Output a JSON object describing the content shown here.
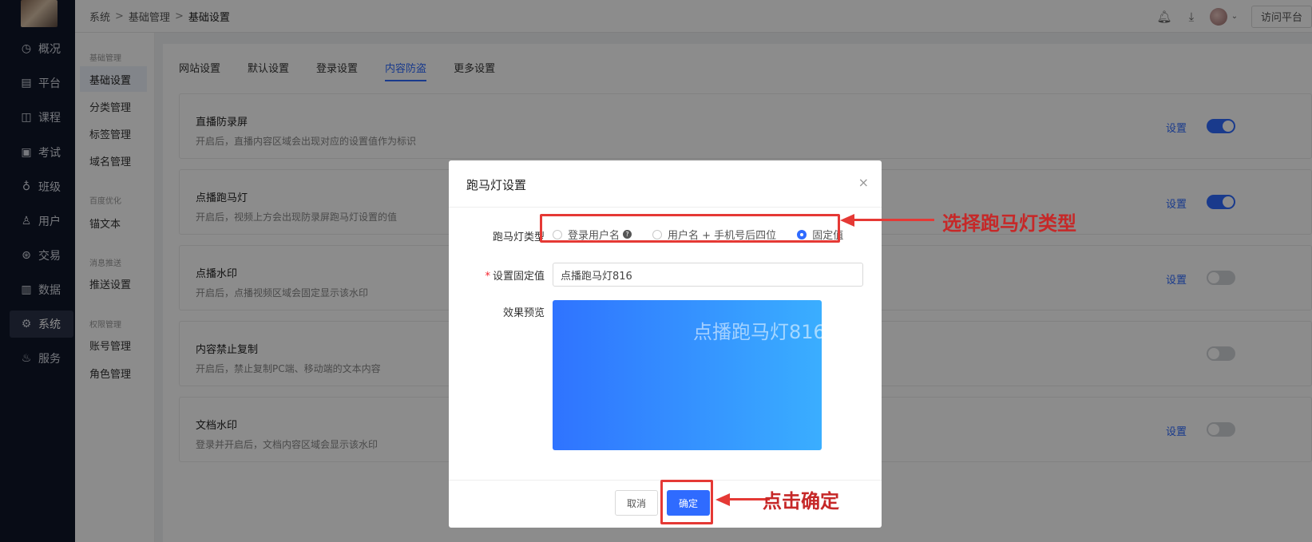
{
  "breadcrumb": [
    "系统",
    "基础管理",
    "基础设置"
  ],
  "breadcrumb_sep": ">",
  "top_actions": {
    "bell_icon": "bell-icon",
    "download_icon": "download-icon",
    "visit_label": "访问平台"
  },
  "nav": {
    "items": [
      {
        "label": "概况",
        "icon": "◷"
      },
      {
        "label": "平台",
        "icon": "▤"
      },
      {
        "label": "课程",
        "icon": "◫"
      },
      {
        "label": "考试",
        "icon": "▣"
      },
      {
        "label": "班级",
        "icon": "♁"
      },
      {
        "label": "用户",
        "icon": "♙"
      },
      {
        "label": "交易",
        "icon": "⊛"
      },
      {
        "label": "数据",
        "icon": "▥"
      },
      {
        "label": "系统",
        "icon": "⚙"
      },
      {
        "label": "服务",
        "icon": "♨"
      }
    ]
  },
  "subnav": {
    "groups": [
      "基础管理",
      "百度优化",
      "消息推送",
      "权限管理"
    ],
    "items": [
      "基础设置",
      "分类管理",
      "标签管理",
      "域名管理",
      "锚文本",
      "推送设置",
      "账号管理",
      "角色管理"
    ]
  },
  "tabs": [
    "网站设置",
    "默认设置",
    "登录设置",
    "内容防盗",
    "更多设置"
  ],
  "settings": [
    {
      "title": "直播防录屏",
      "desc": "开启后，直播内容区域会出现对应的设置值作为标识",
      "link": "设置"
    },
    {
      "title": "点播跑马灯",
      "desc": "开启后，视频上方会出现防录屏跑马灯设置的值",
      "link": "设置"
    },
    {
      "title": "点播水印",
      "desc": "开启后，点播视频区域会固定显示该水印",
      "link": "设置"
    },
    {
      "title": "内容禁止复制",
      "desc": "开启后，禁止复制PC端、移动端的文本内容"
    },
    {
      "title": "文档水印",
      "desc": "登录并开启后，文档内容区域会显示该水印",
      "link": "设置"
    }
  ],
  "toggles": [
    true,
    true,
    false,
    false,
    false
  ],
  "modal": {
    "title": "跑马灯设置",
    "close": "×",
    "type_label": "跑马灯类型",
    "options": [
      "登录用户名",
      "用户名 + 手机号后四位",
      "固定值"
    ],
    "selected": "固定值",
    "help": "?",
    "value_label": "设置固定值",
    "value": "点播跑马灯816",
    "preview_label": "效果预览",
    "preview_text": "点播跑马灯816",
    "cancel": "取消",
    "ok": "确定"
  },
  "annotations": {
    "select_type": "选择跑马灯类型",
    "click_ok": "点击确定"
  },
  "colors": {
    "primary": "#2f6bff",
    "nav_bg": "#0f1629",
    "annotation": "#e53935"
  }
}
